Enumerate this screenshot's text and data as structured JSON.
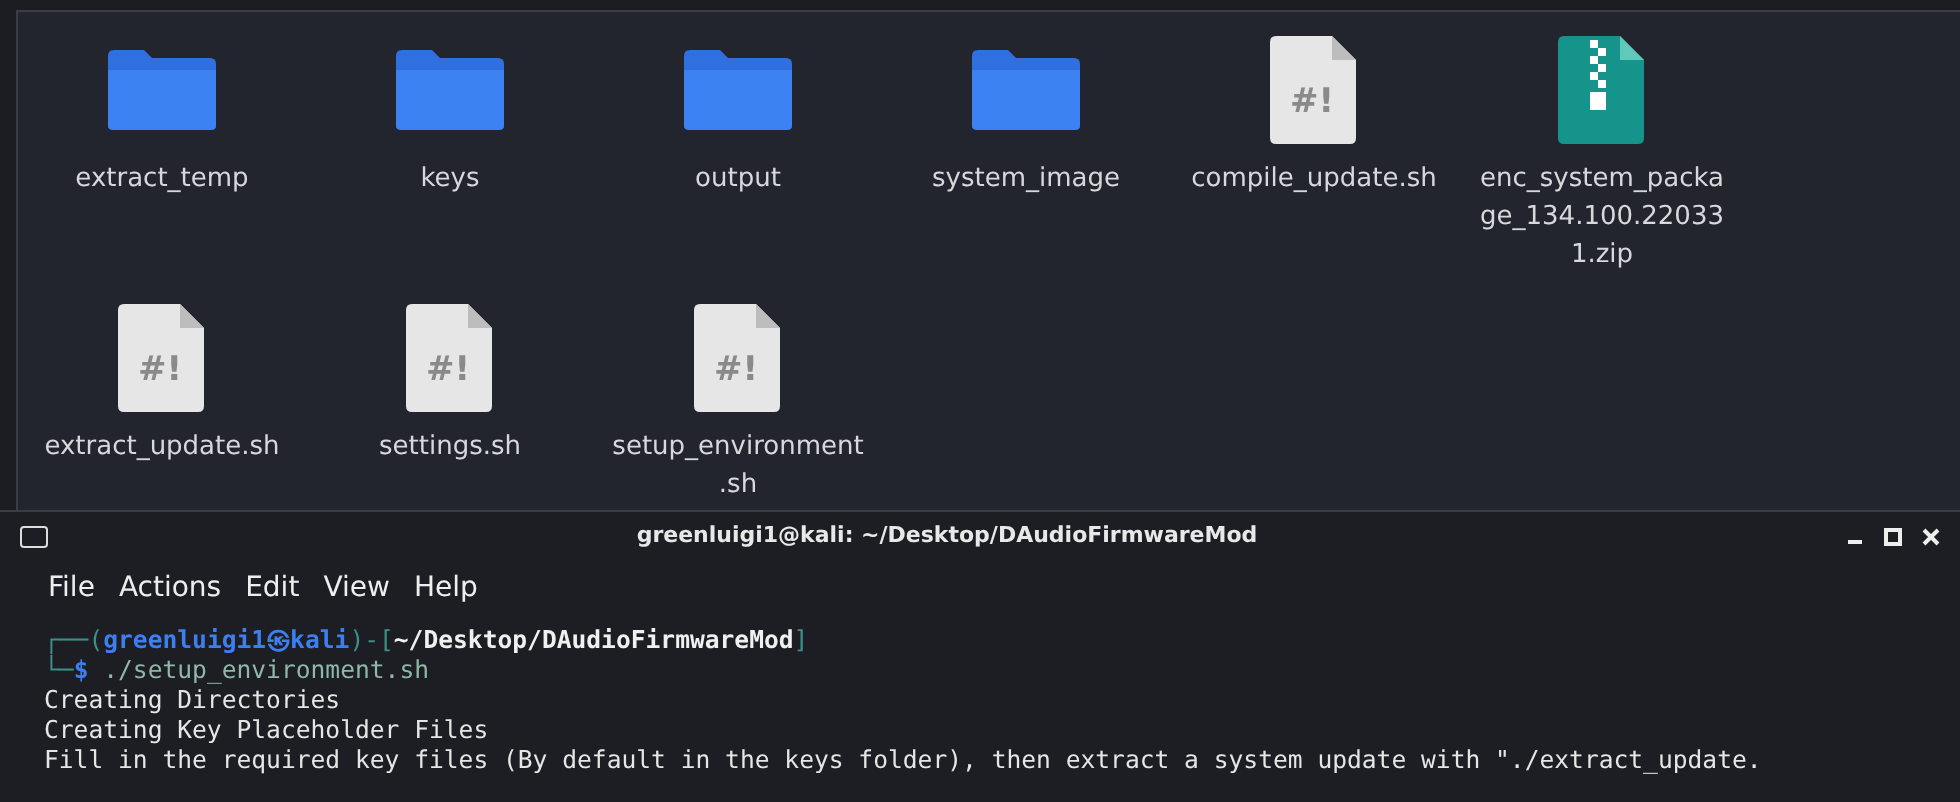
{
  "files": [
    {
      "name": "extract_temp",
      "kind": "folder"
    },
    {
      "name": "keys",
      "kind": "folder"
    },
    {
      "name": "output",
      "kind": "folder"
    },
    {
      "name": "system_image",
      "kind": "folder"
    },
    {
      "name": "compile_update.sh",
      "kind": "script",
      "glyph": "#!"
    },
    {
      "name": "enc_system_package_134.100.220331.zip",
      "kind": "archive"
    },
    {
      "name": "extract_update.sh",
      "kind": "script",
      "glyph": "#!"
    },
    {
      "name": "settings.sh",
      "kind": "script",
      "glyph": "#!"
    },
    {
      "name": "setup_environment.sh",
      "kind": "script",
      "glyph": "#!"
    }
  ],
  "terminal": {
    "title": "greenluigi1@kali: ~/Desktop/DAudioFirmwareMod",
    "menu": [
      "File",
      "Actions",
      "Edit",
      "View",
      "Help"
    ],
    "lines": [
      {
        "segments": [
          {
            "text": "┌──(",
            "kind": "frame"
          },
          {
            "text": "greenluigi1㉿kali",
            "kind": "user"
          },
          {
            "text": ")-[",
            "kind": "frame"
          },
          {
            "text": "~/Desktop/DAudioFirmwareMod",
            "kind": "path"
          },
          {
            "text": "]",
            "kind": "frame"
          }
        ]
      },
      {
        "segments": [
          {
            "text": "└─",
            "kind": "frame"
          },
          {
            "text": "$",
            "kind": "user"
          },
          {
            "text": " ./setup_environment.sh",
            "kind": "command"
          }
        ]
      },
      {
        "segments": [
          {
            "text": "Creating Directories",
            "kind": "output"
          }
        ]
      },
      {
        "segments": [
          {
            "text": "Creating Key Placeholder Files",
            "kind": "output"
          }
        ]
      },
      {
        "segments": [
          {
            "text": "Fill in the required key files (By default in the keys folder), then extract a system update with \"./extract_update.",
            "kind": "output"
          }
        ]
      }
    ]
  }
}
